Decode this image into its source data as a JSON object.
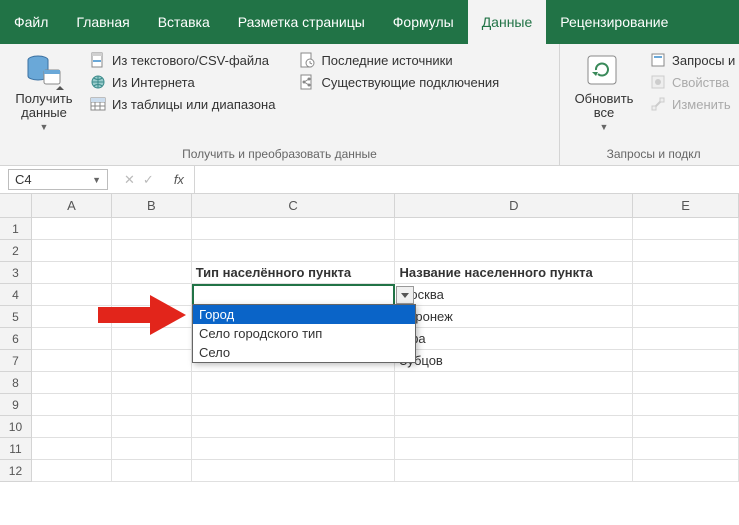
{
  "tabs": {
    "file": "Файл",
    "home": "Главная",
    "insert": "Вставка",
    "pagelayout": "Разметка страницы",
    "formulas": "Формулы",
    "data": "Данные",
    "review": "Рецензирование"
  },
  "ribbon": {
    "getdata": {
      "label": "Получить данные",
      "from_csv": "Из текстового/CSV-файла",
      "from_web": "Из Интернета",
      "from_table": "Из таблицы или диапазона",
      "recent": "Последние источники",
      "existing": "Существующие подключения",
      "caption": "Получить и преобразовать данные"
    },
    "queries": {
      "refresh": "Обновить все",
      "queries": "Запросы и",
      "properties": "Свойства",
      "edit": "Изменить",
      "caption": "Запросы и подкл"
    }
  },
  "namebox": "C4",
  "fx_label": "fx",
  "columns": {
    "A": "A",
    "B": "B",
    "C": "C",
    "D": "D",
    "E": "E"
  },
  "rows": [
    "1",
    "2",
    "3",
    "4",
    "5",
    "6",
    "7",
    "8",
    "9",
    "10",
    "11",
    "12"
  ],
  "cells": {
    "C3": "Тип населённого пункта",
    "D3": "Название населенного пункта",
    "D4": "Москва",
    "D5": "Воронеж",
    "D6": "Уфа",
    "D7": "Зубцов"
  },
  "dropdown": {
    "options": [
      "Город",
      "Село городского тип",
      "Село"
    ],
    "selected_index": 0
  }
}
